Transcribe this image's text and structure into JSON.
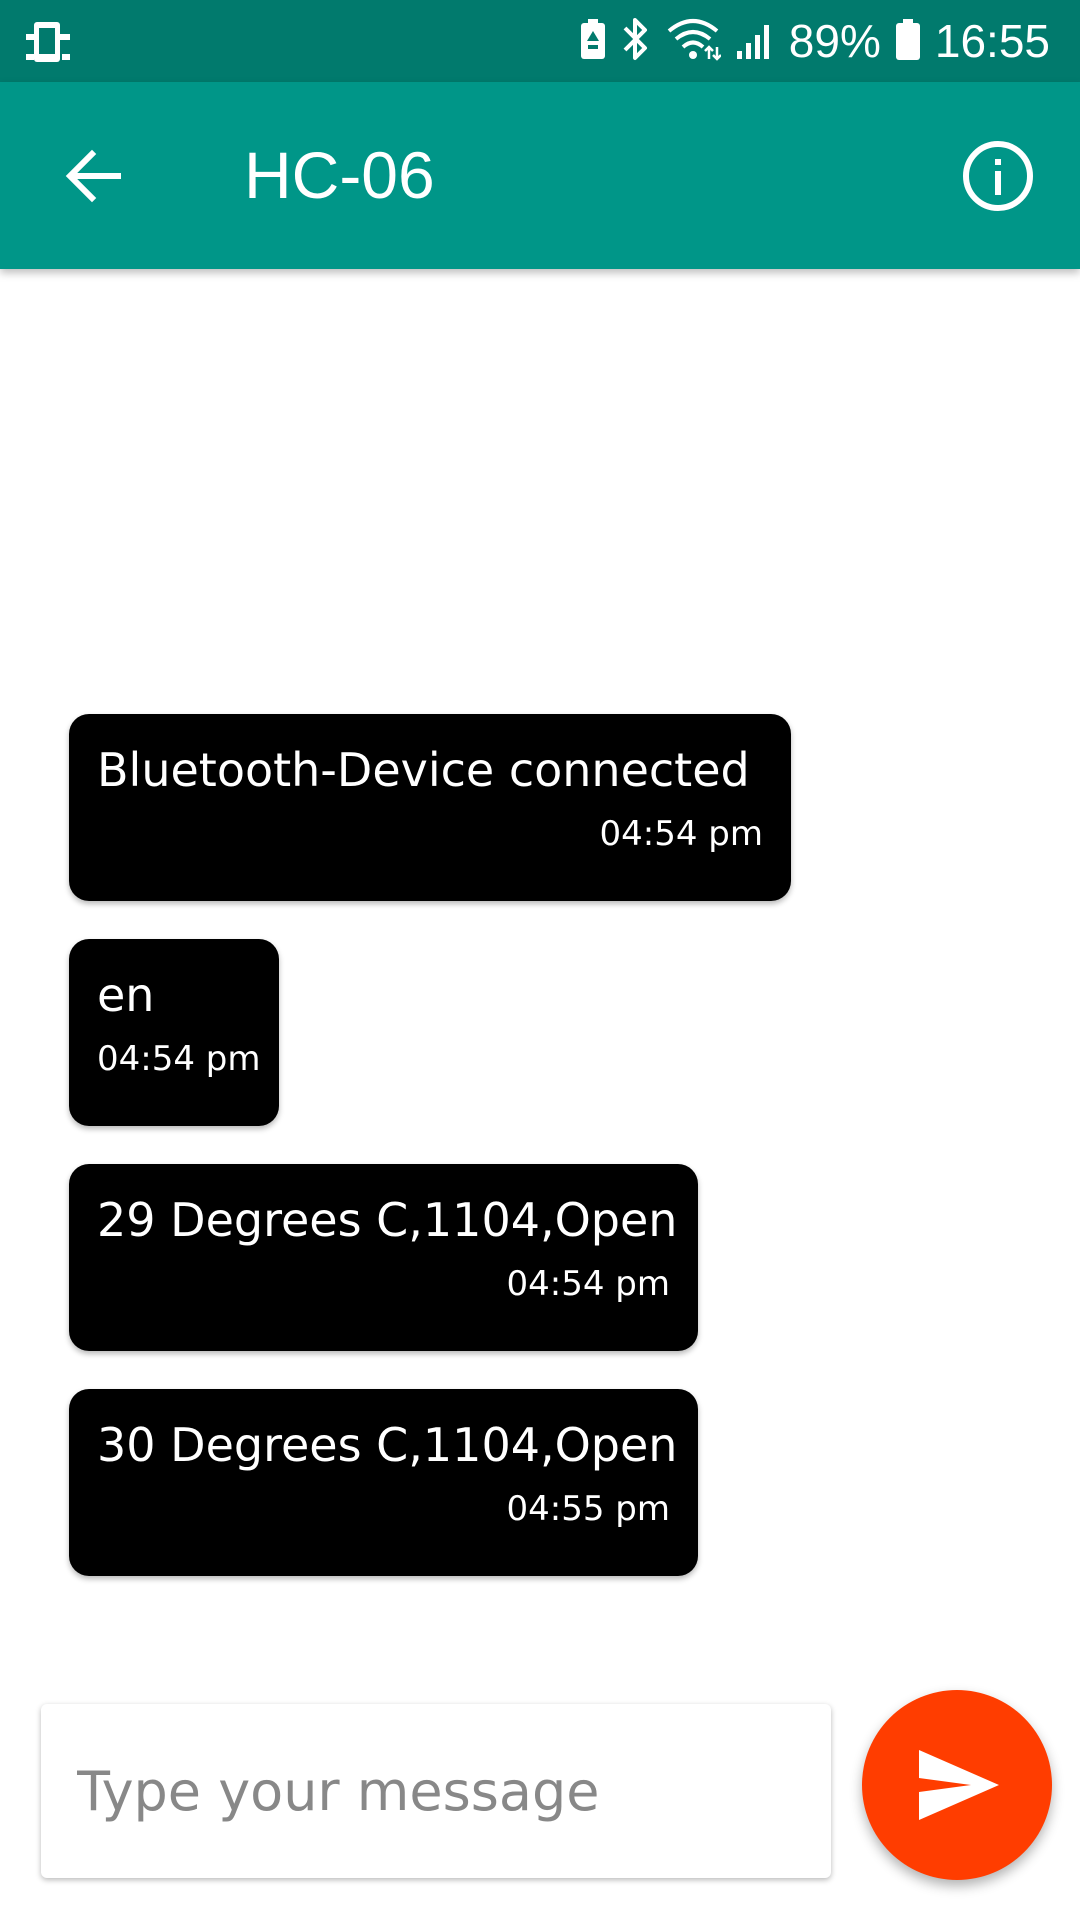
{
  "status_bar": {
    "battery_percent": "89%",
    "time": "16:55",
    "icons": [
      "device-icon",
      "battery-saver-icon",
      "bluetooth-icon",
      "wifi-icon",
      "signal-icon",
      "battery-icon"
    ]
  },
  "app_bar": {
    "title": "HC-06",
    "back_icon": "arrow-back-icon",
    "info_icon": "info-icon",
    "color": "#009688"
  },
  "messages": [
    {
      "text": "Bluetooth-Device connected",
      "time": "04:54 pm"
    },
    {
      "text": "en",
      "time": "04:54 pm"
    },
    {
      "text": "29 Degrees C,1104,Open",
      "time": "04:54 pm"
    },
    {
      "text": "30 Degrees C,1104,Open",
      "time": "04:55 pm"
    }
  ],
  "composer": {
    "placeholder": "Type your message",
    "value": "",
    "send_icon": "send-icon",
    "send_color": "#ff3d00"
  }
}
